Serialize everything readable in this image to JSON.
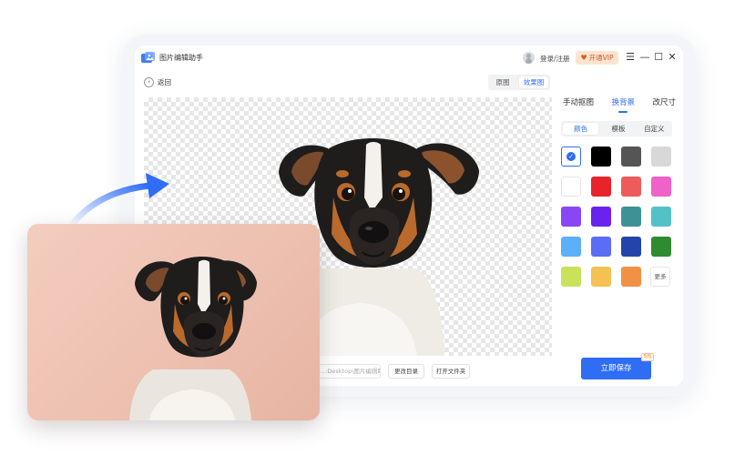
{
  "app": {
    "title": "图片编辑助手",
    "login": "登录/注册",
    "vip": "开通VIP"
  },
  "toolbar": {
    "back": "返回",
    "view_original": "原图",
    "view_result": "效果图"
  },
  "bottom": {
    "path_placeholder": "...:Desktop\\图片编辑助手",
    "change_dir": "更改目录",
    "open_folder": "打开文件夹"
  },
  "panel": {
    "tabs": [
      "手动抠图",
      "换背景",
      "改尺寸"
    ],
    "active_tab": "换背景",
    "segments": [
      "颜色",
      "模板",
      "自定义"
    ],
    "active_segment": "颜色",
    "colors": [
      "#ffffff",
      "#000000",
      "#555555",
      "#d8d8d8",
      "#ffffff",
      "#e8232b",
      "#ee5b5b",
      "#ef62c7",
      "#8747f5",
      "#6a22ee",
      "#3e9295",
      "#54c1c7",
      "#5caff9",
      "#5b6cf5",
      "#2444ac",
      "#2f8a31",
      "#c9e25a",
      "#f4c152",
      "#f29146"
    ],
    "more": "更多",
    "save": "立即保存",
    "save_badge": "5元"
  },
  "accent": "#2f6df5"
}
